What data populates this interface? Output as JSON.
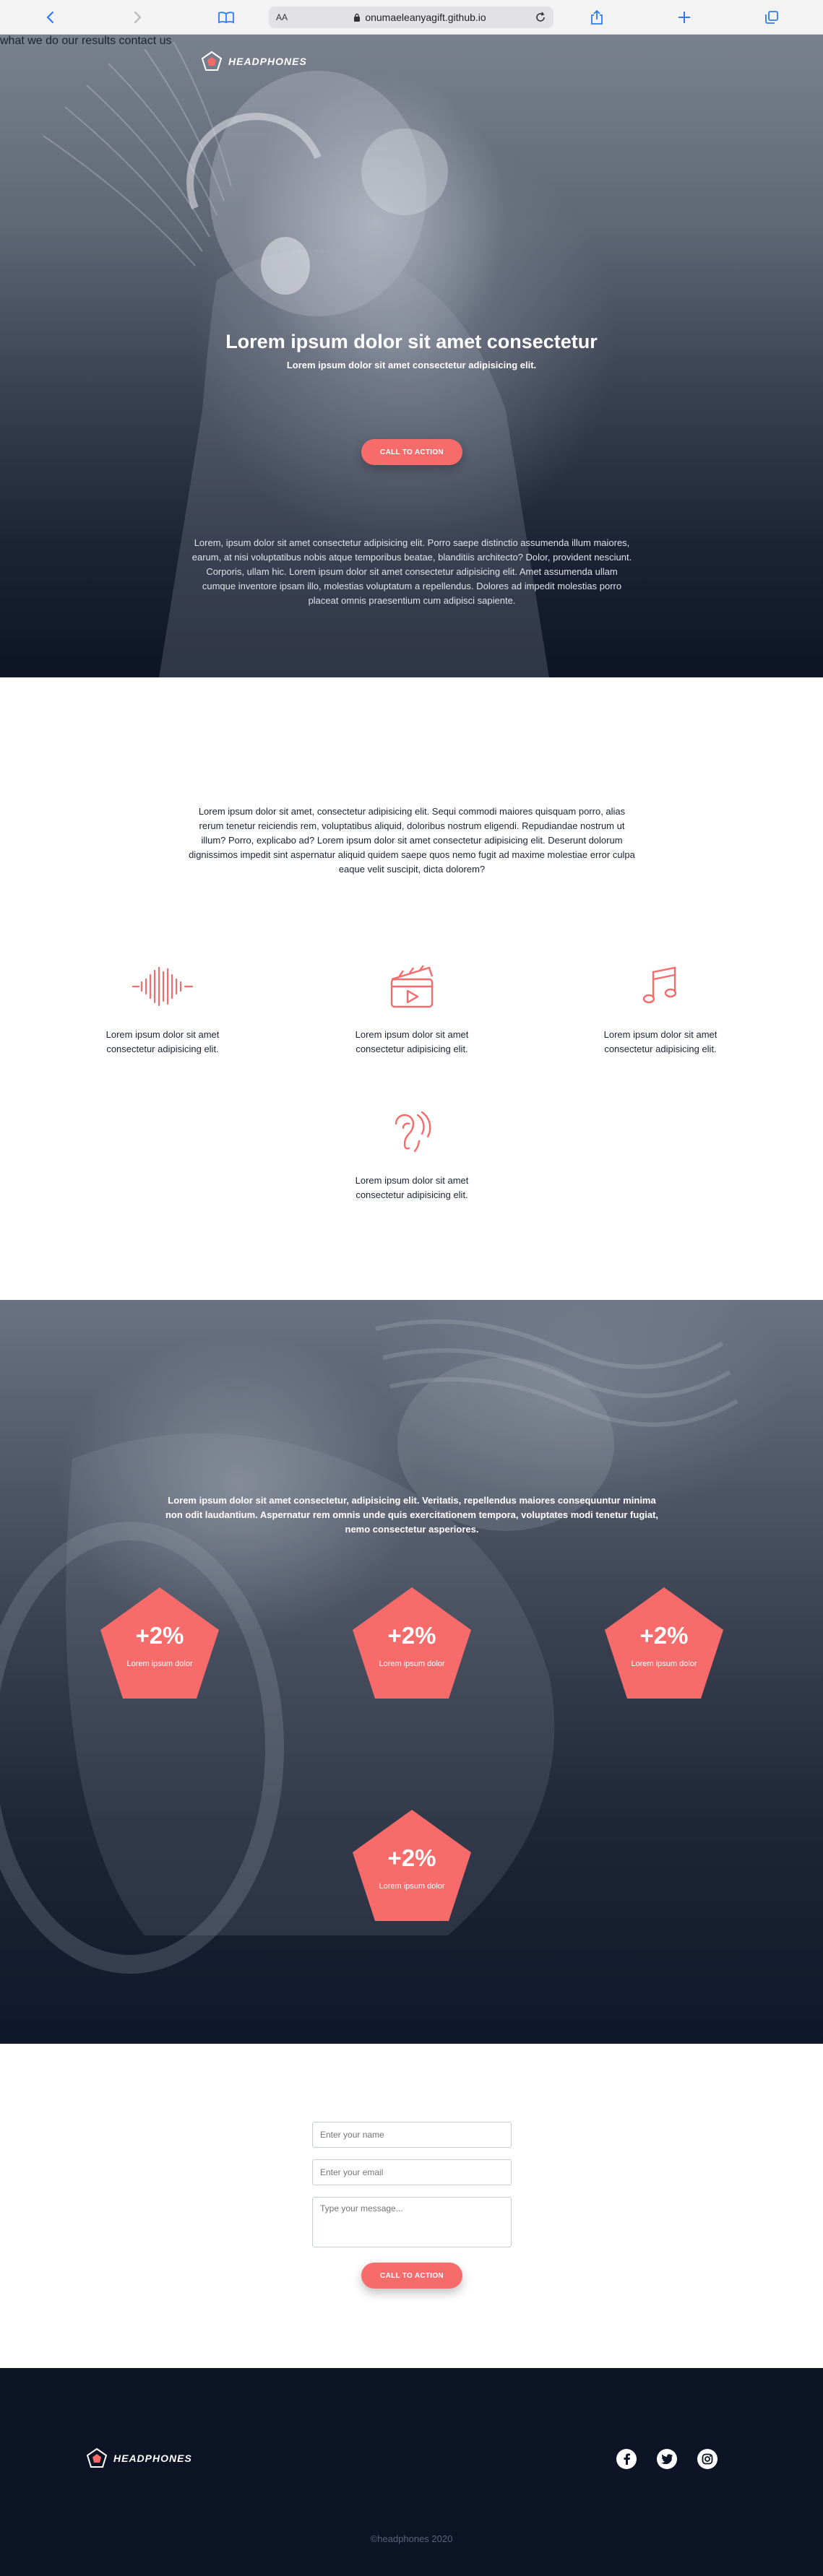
{
  "browser": {
    "text_size_label": "AA",
    "url": "onumaeleanyagift.github.io"
  },
  "brand": {
    "name": "HEADPHONES",
    "accent": "#f76b6b",
    "dark": "#0c1426"
  },
  "nav": {
    "items": [
      "what we do",
      "our results",
      "contact us"
    ]
  },
  "hero": {
    "title": "Lorem ipsum dolor sit amet consectetur",
    "subtitle": "Lorem ipsum dolor sit amet consectetur adipisicing elit.",
    "cta": "CALL TO ACTION",
    "paragraph": "Lorem, ipsum dolor sit amet consectetur adipisicing elit. Porro saepe distinctio assumenda illum maiores, earum, at nisi voluptatibus nobis atque temporibus beatae, blanditiis architecto? Dolor, provident nesciunt. Corporis, ullam hic. Lorem ipsum dolor sit amet consectetur adipisicing elit. Amet assumenda ullam cumque inventore ipsam illo, molestias voluptatum a repellendus. Dolores ad impedit molestias porro placeat omnis praesentium cum adipisci sapiente."
  },
  "intro": {
    "paragraph": "Lorem ipsum dolor sit amet, consectetur adipisicing elit. Sequi commodi maiores quisquam porro, alias rerum tenetur reiciendis rem, voluptatibus aliquid, doloribus nostrum eligendi. Repudiandae nostrum ut illum? Porro, explicabo ad? Lorem ipsum dolor sit amet consectetur adipisicing elit. Deserunt dolorum dignissimos impedit sint aspernatur aliquid quidem saepe quos nemo fugit ad maxime molestiae error culpa eaque velit suscipit, dicta dolorem?"
  },
  "features": [
    {
      "icon": "sound-wave-icon",
      "text": "Lorem ipsum dolor sit amet consectetur adipisicing elit."
    },
    {
      "icon": "clapperboard-icon",
      "text": "Lorem ipsum dolor sit amet consectetur adipisicing elit."
    },
    {
      "icon": "music-note-icon",
      "text": "Lorem ipsum dolor sit amet consectetur adipisicing elit."
    },
    {
      "icon": "hearing-icon",
      "text": "Lorem ipsum dolor sit amet consectetur adipisicing elit."
    }
  ],
  "stats": {
    "paragraph": "Lorem ipsum dolor sit amet consectetur, adipisicing elit. Veritatis, repellendus maiores consequuntur minima non odit laudantium. Aspernatur rem omnis unde quis exercitationem tempora, voluptates modi tenetur fugiat, nemo consectetur asperiores.",
    "items": [
      {
        "value": "+2%",
        "label": "Lorem ipsum dolor"
      },
      {
        "value": "+2%",
        "label": "Lorem ipsum dolor"
      },
      {
        "value": "+2%",
        "label": "Lorem ipsum dolor"
      },
      {
        "value": "+2%",
        "label": "Lorem ipsum dolor"
      }
    ]
  },
  "contact": {
    "name_placeholder": "Enter your name",
    "email_placeholder": "Enter your email",
    "message_placeholder": "Type your message...",
    "cta": "CALL TO ACTION"
  },
  "footer": {
    "social": [
      "facebook-icon",
      "twitter-icon",
      "instagram-icon"
    ],
    "copyright": "©headphones 2020"
  }
}
